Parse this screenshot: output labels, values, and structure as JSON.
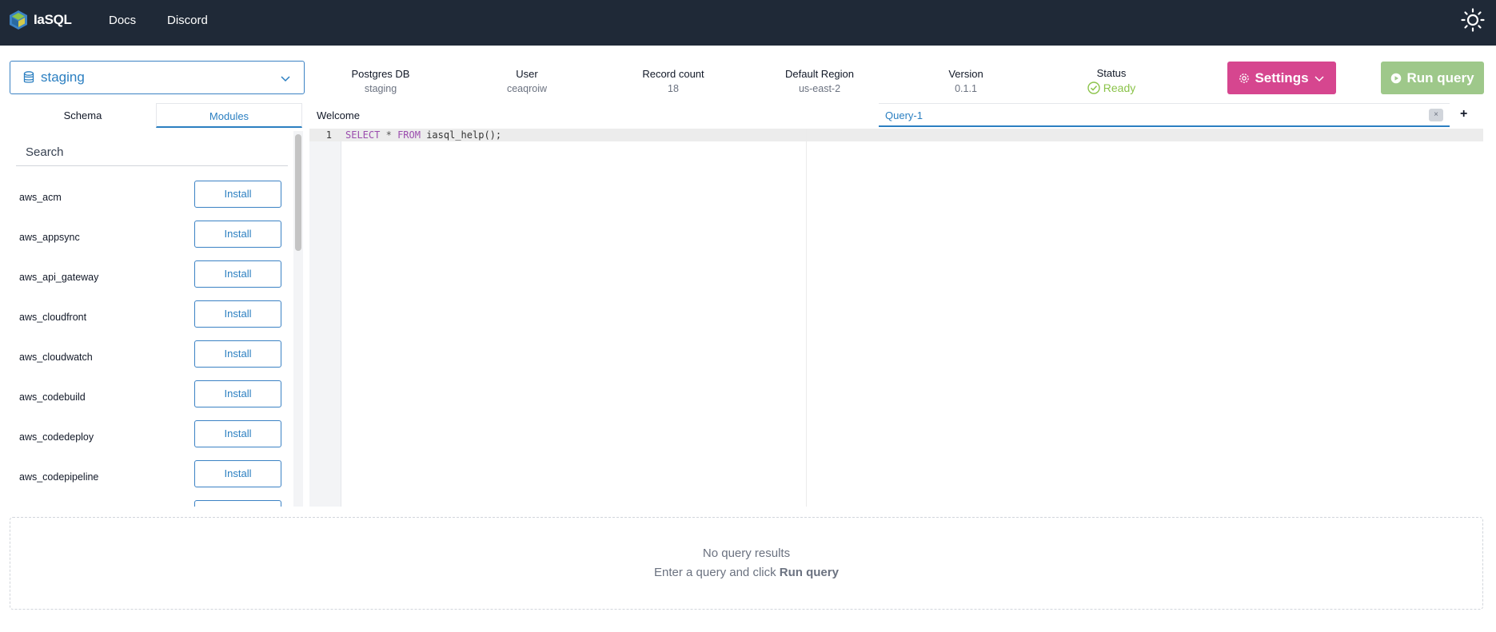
{
  "nav": {
    "logo_text": "IaSQL",
    "links": [
      "Docs",
      "Discord"
    ]
  },
  "db_select": {
    "value": "staging"
  },
  "stats": [
    {
      "key": "Postgres DB",
      "value": "staging"
    },
    {
      "key": "User",
      "value": "ceaqroiw"
    },
    {
      "key": "Record count",
      "value": "18"
    },
    {
      "key": "Default Region",
      "value": "us-east-2"
    },
    {
      "key": "Version",
      "value": "0.1.1"
    },
    {
      "key": "Status",
      "value": "Ready"
    }
  ],
  "buttons": {
    "settings": "Settings",
    "run_query": "Run query"
  },
  "left_tabs": [
    "Schema",
    "Modules"
  ],
  "search": {
    "placeholder": "Search",
    "value": ""
  },
  "modules": {
    "install_label": "Install",
    "items": [
      "aws_acm",
      "aws_appsync",
      "aws_api_gateway",
      "aws_cloudfront",
      "aws_cloudwatch",
      "aws_codebuild",
      "aws_codedeploy",
      "aws_codepipeline"
    ]
  },
  "editor_tabs": {
    "welcome": "Welcome",
    "query": "Query-1",
    "close": "×",
    "add": "+"
  },
  "editor": {
    "line_number": "1",
    "code": {
      "kw1": "SELECT",
      "star": "*",
      "kw2": "FROM",
      "rest": "iasql_help();"
    }
  },
  "results": {
    "empty_title": "No query results",
    "hint_prefix": "Enter a query and click",
    "hint_action": "Run query"
  },
  "colors": {
    "topbar": "#1f2937",
    "accent": "#2b7fc1",
    "settings": "#d6468f",
    "run": "#9ec88a",
    "ready": "#8bc34a"
  }
}
